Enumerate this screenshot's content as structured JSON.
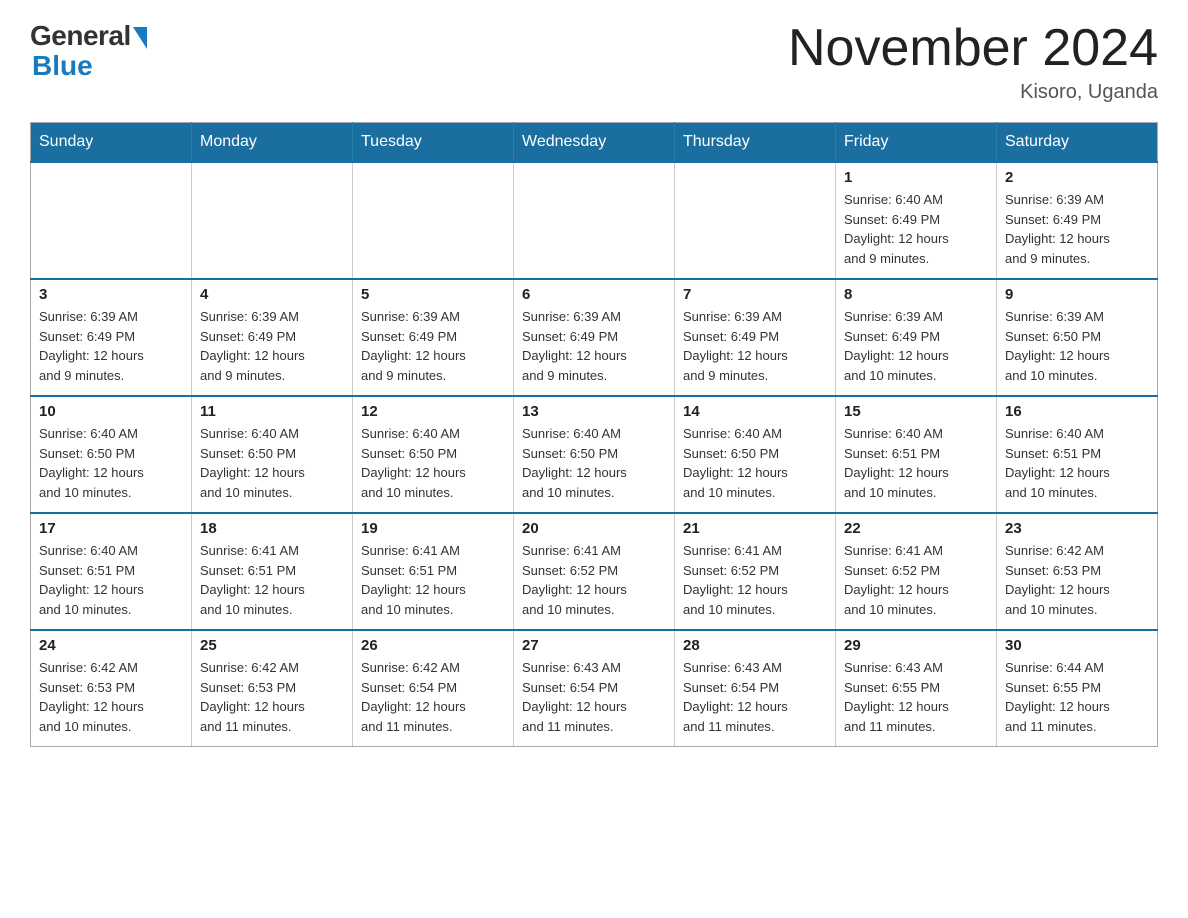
{
  "logo": {
    "general": "General",
    "blue": "Blue"
  },
  "title": "November 2024",
  "subtitle": "Kisoro, Uganda",
  "weekdays": [
    "Sunday",
    "Monday",
    "Tuesday",
    "Wednesday",
    "Thursday",
    "Friday",
    "Saturday"
  ],
  "weeks": [
    [
      {
        "day": "",
        "info": ""
      },
      {
        "day": "",
        "info": ""
      },
      {
        "day": "",
        "info": ""
      },
      {
        "day": "",
        "info": ""
      },
      {
        "day": "",
        "info": ""
      },
      {
        "day": "1",
        "info": "Sunrise: 6:40 AM\nSunset: 6:49 PM\nDaylight: 12 hours\nand 9 minutes."
      },
      {
        "day": "2",
        "info": "Sunrise: 6:39 AM\nSunset: 6:49 PM\nDaylight: 12 hours\nand 9 minutes."
      }
    ],
    [
      {
        "day": "3",
        "info": "Sunrise: 6:39 AM\nSunset: 6:49 PM\nDaylight: 12 hours\nand 9 minutes."
      },
      {
        "day": "4",
        "info": "Sunrise: 6:39 AM\nSunset: 6:49 PM\nDaylight: 12 hours\nand 9 minutes."
      },
      {
        "day": "5",
        "info": "Sunrise: 6:39 AM\nSunset: 6:49 PM\nDaylight: 12 hours\nand 9 minutes."
      },
      {
        "day": "6",
        "info": "Sunrise: 6:39 AM\nSunset: 6:49 PM\nDaylight: 12 hours\nand 9 minutes."
      },
      {
        "day": "7",
        "info": "Sunrise: 6:39 AM\nSunset: 6:49 PM\nDaylight: 12 hours\nand 9 minutes."
      },
      {
        "day": "8",
        "info": "Sunrise: 6:39 AM\nSunset: 6:49 PM\nDaylight: 12 hours\nand 10 minutes."
      },
      {
        "day": "9",
        "info": "Sunrise: 6:39 AM\nSunset: 6:50 PM\nDaylight: 12 hours\nand 10 minutes."
      }
    ],
    [
      {
        "day": "10",
        "info": "Sunrise: 6:40 AM\nSunset: 6:50 PM\nDaylight: 12 hours\nand 10 minutes."
      },
      {
        "day": "11",
        "info": "Sunrise: 6:40 AM\nSunset: 6:50 PM\nDaylight: 12 hours\nand 10 minutes."
      },
      {
        "day": "12",
        "info": "Sunrise: 6:40 AM\nSunset: 6:50 PM\nDaylight: 12 hours\nand 10 minutes."
      },
      {
        "day": "13",
        "info": "Sunrise: 6:40 AM\nSunset: 6:50 PM\nDaylight: 12 hours\nand 10 minutes."
      },
      {
        "day": "14",
        "info": "Sunrise: 6:40 AM\nSunset: 6:50 PM\nDaylight: 12 hours\nand 10 minutes."
      },
      {
        "day": "15",
        "info": "Sunrise: 6:40 AM\nSunset: 6:51 PM\nDaylight: 12 hours\nand 10 minutes."
      },
      {
        "day": "16",
        "info": "Sunrise: 6:40 AM\nSunset: 6:51 PM\nDaylight: 12 hours\nand 10 minutes."
      }
    ],
    [
      {
        "day": "17",
        "info": "Sunrise: 6:40 AM\nSunset: 6:51 PM\nDaylight: 12 hours\nand 10 minutes."
      },
      {
        "day": "18",
        "info": "Sunrise: 6:41 AM\nSunset: 6:51 PM\nDaylight: 12 hours\nand 10 minutes."
      },
      {
        "day": "19",
        "info": "Sunrise: 6:41 AM\nSunset: 6:51 PM\nDaylight: 12 hours\nand 10 minutes."
      },
      {
        "day": "20",
        "info": "Sunrise: 6:41 AM\nSunset: 6:52 PM\nDaylight: 12 hours\nand 10 minutes."
      },
      {
        "day": "21",
        "info": "Sunrise: 6:41 AM\nSunset: 6:52 PM\nDaylight: 12 hours\nand 10 minutes."
      },
      {
        "day": "22",
        "info": "Sunrise: 6:41 AM\nSunset: 6:52 PM\nDaylight: 12 hours\nand 10 minutes."
      },
      {
        "day": "23",
        "info": "Sunrise: 6:42 AM\nSunset: 6:53 PM\nDaylight: 12 hours\nand 10 minutes."
      }
    ],
    [
      {
        "day": "24",
        "info": "Sunrise: 6:42 AM\nSunset: 6:53 PM\nDaylight: 12 hours\nand 10 minutes."
      },
      {
        "day": "25",
        "info": "Sunrise: 6:42 AM\nSunset: 6:53 PM\nDaylight: 12 hours\nand 11 minutes."
      },
      {
        "day": "26",
        "info": "Sunrise: 6:42 AM\nSunset: 6:54 PM\nDaylight: 12 hours\nand 11 minutes."
      },
      {
        "day": "27",
        "info": "Sunrise: 6:43 AM\nSunset: 6:54 PM\nDaylight: 12 hours\nand 11 minutes."
      },
      {
        "day": "28",
        "info": "Sunrise: 6:43 AM\nSunset: 6:54 PM\nDaylight: 12 hours\nand 11 minutes."
      },
      {
        "day": "29",
        "info": "Sunrise: 6:43 AM\nSunset: 6:55 PM\nDaylight: 12 hours\nand 11 minutes."
      },
      {
        "day": "30",
        "info": "Sunrise: 6:44 AM\nSunset: 6:55 PM\nDaylight: 12 hours\nand 11 minutes."
      }
    ]
  ]
}
